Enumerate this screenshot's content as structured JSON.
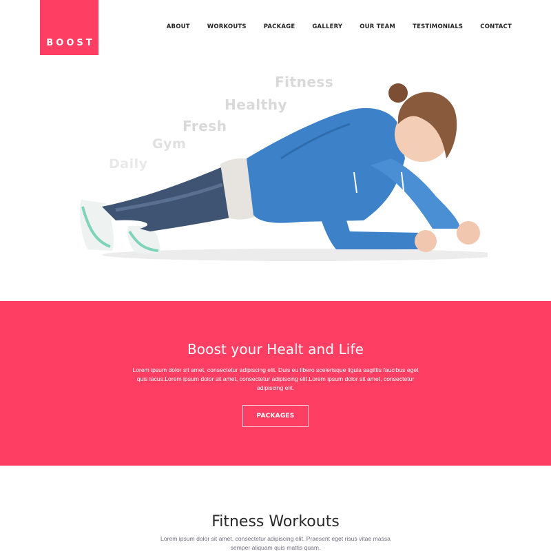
{
  "brand": {
    "name": "BOOST",
    "color": "#ff3e63"
  },
  "nav": {
    "items": [
      {
        "label": "ABOUT"
      },
      {
        "label": "WORKOUTS"
      },
      {
        "label": "PACKAGE"
      },
      {
        "label": "GALLERY"
      },
      {
        "label": "OUR TEAM"
      },
      {
        "label": "TESTIMONIALS"
      },
      {
        "label": "CONTACT"
      }
    ]
  },
  "hero": {
    "words": [
      "Fitness",
      "Healthy",
      "Fresh",
      "Gym",
      "Daily"
    ]
  },
  "band": {
    "title": "Boost your Healt and Life",
    "text": "Lorem ipsum dolor sit amet, consectetur adipiscing elit. Duis eu libero scelerisque ligula sagittis faucibus eget quis lacus.Lorem ipsum dolor sit amet, consectetur adipiscing elit.Lorem ipsum dolor sit amet, consectetur adipiscing elit.",
    "button_label": "PACKAGES"
  },
  "workouts": {
    "title": "Fitness Workouts",
    "text": "Lorem ipsum dolor sit amet, consectetur adipiscing elit. Praesent eget risus vitae massa semper aliquam quis mattis quam."
  }
}
